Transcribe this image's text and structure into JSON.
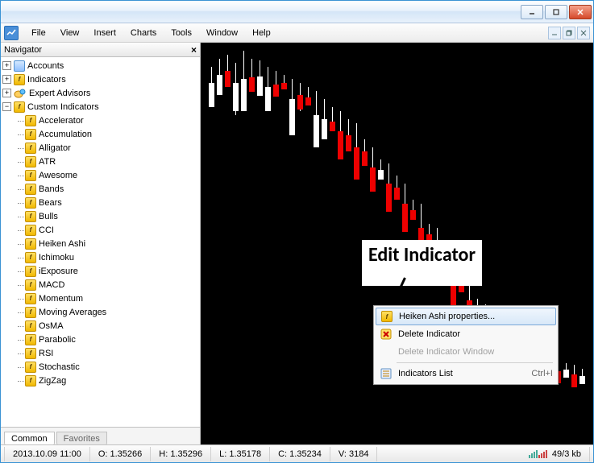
{
  "menubar": {
    "items": [
      "File",
      "View",
      "Insert",
      "Charts",
      "Tools",
      "Window",
      "Help"
    ]
  },
  "navigator": {
    "title": "Navigator",
    "groups": {
      "accounts": "Accounts",
      "indicators": "Indicators",
      "advisors": "Expert Advisors",
      "custom": "Custom Indicators"
    },
    "custom_items": [
      "Accelerator",
      "Accumulation",
      "Alligator",
      "ATR",
      "Awesome",
      "Bands",
      "Bears",
      "Bulls",
      "CCI",
      "Heiken Ashi",
      "Ichimoku",
      "iExposure",
      "MACD",
      "Momentum",
      "Moving Averages",
      "OsMA",
      "Parabolic",
      "RSI",
      "Stochastic",
      "ZigZag"
    ],
    "tabs": {
      "common": "Common",
      "favorites": "Favorites"
    }
  },
  "context_menu": {
    "properties": "Heiken Ashi properties...",
    "delete": "Delete Indicator",
    "delete_window": "Delete Indicator Window",
    "list": "Indicators List",
    "list_shortcut": "Ctrl+I"
  },
  "annotation": {
    "text": "Edit Indicator"
  },
  "statusbar": {
    "datetime": "2013.10.09 11:00",
    "open": "O: 1.35266",
    "high": "H: 1.35296",
    "low": "L: 1.35178",
    "close": "C: 1.35234",
    "volume": "V: 3184",
    "conn": "49/3 kb"
  }
}
